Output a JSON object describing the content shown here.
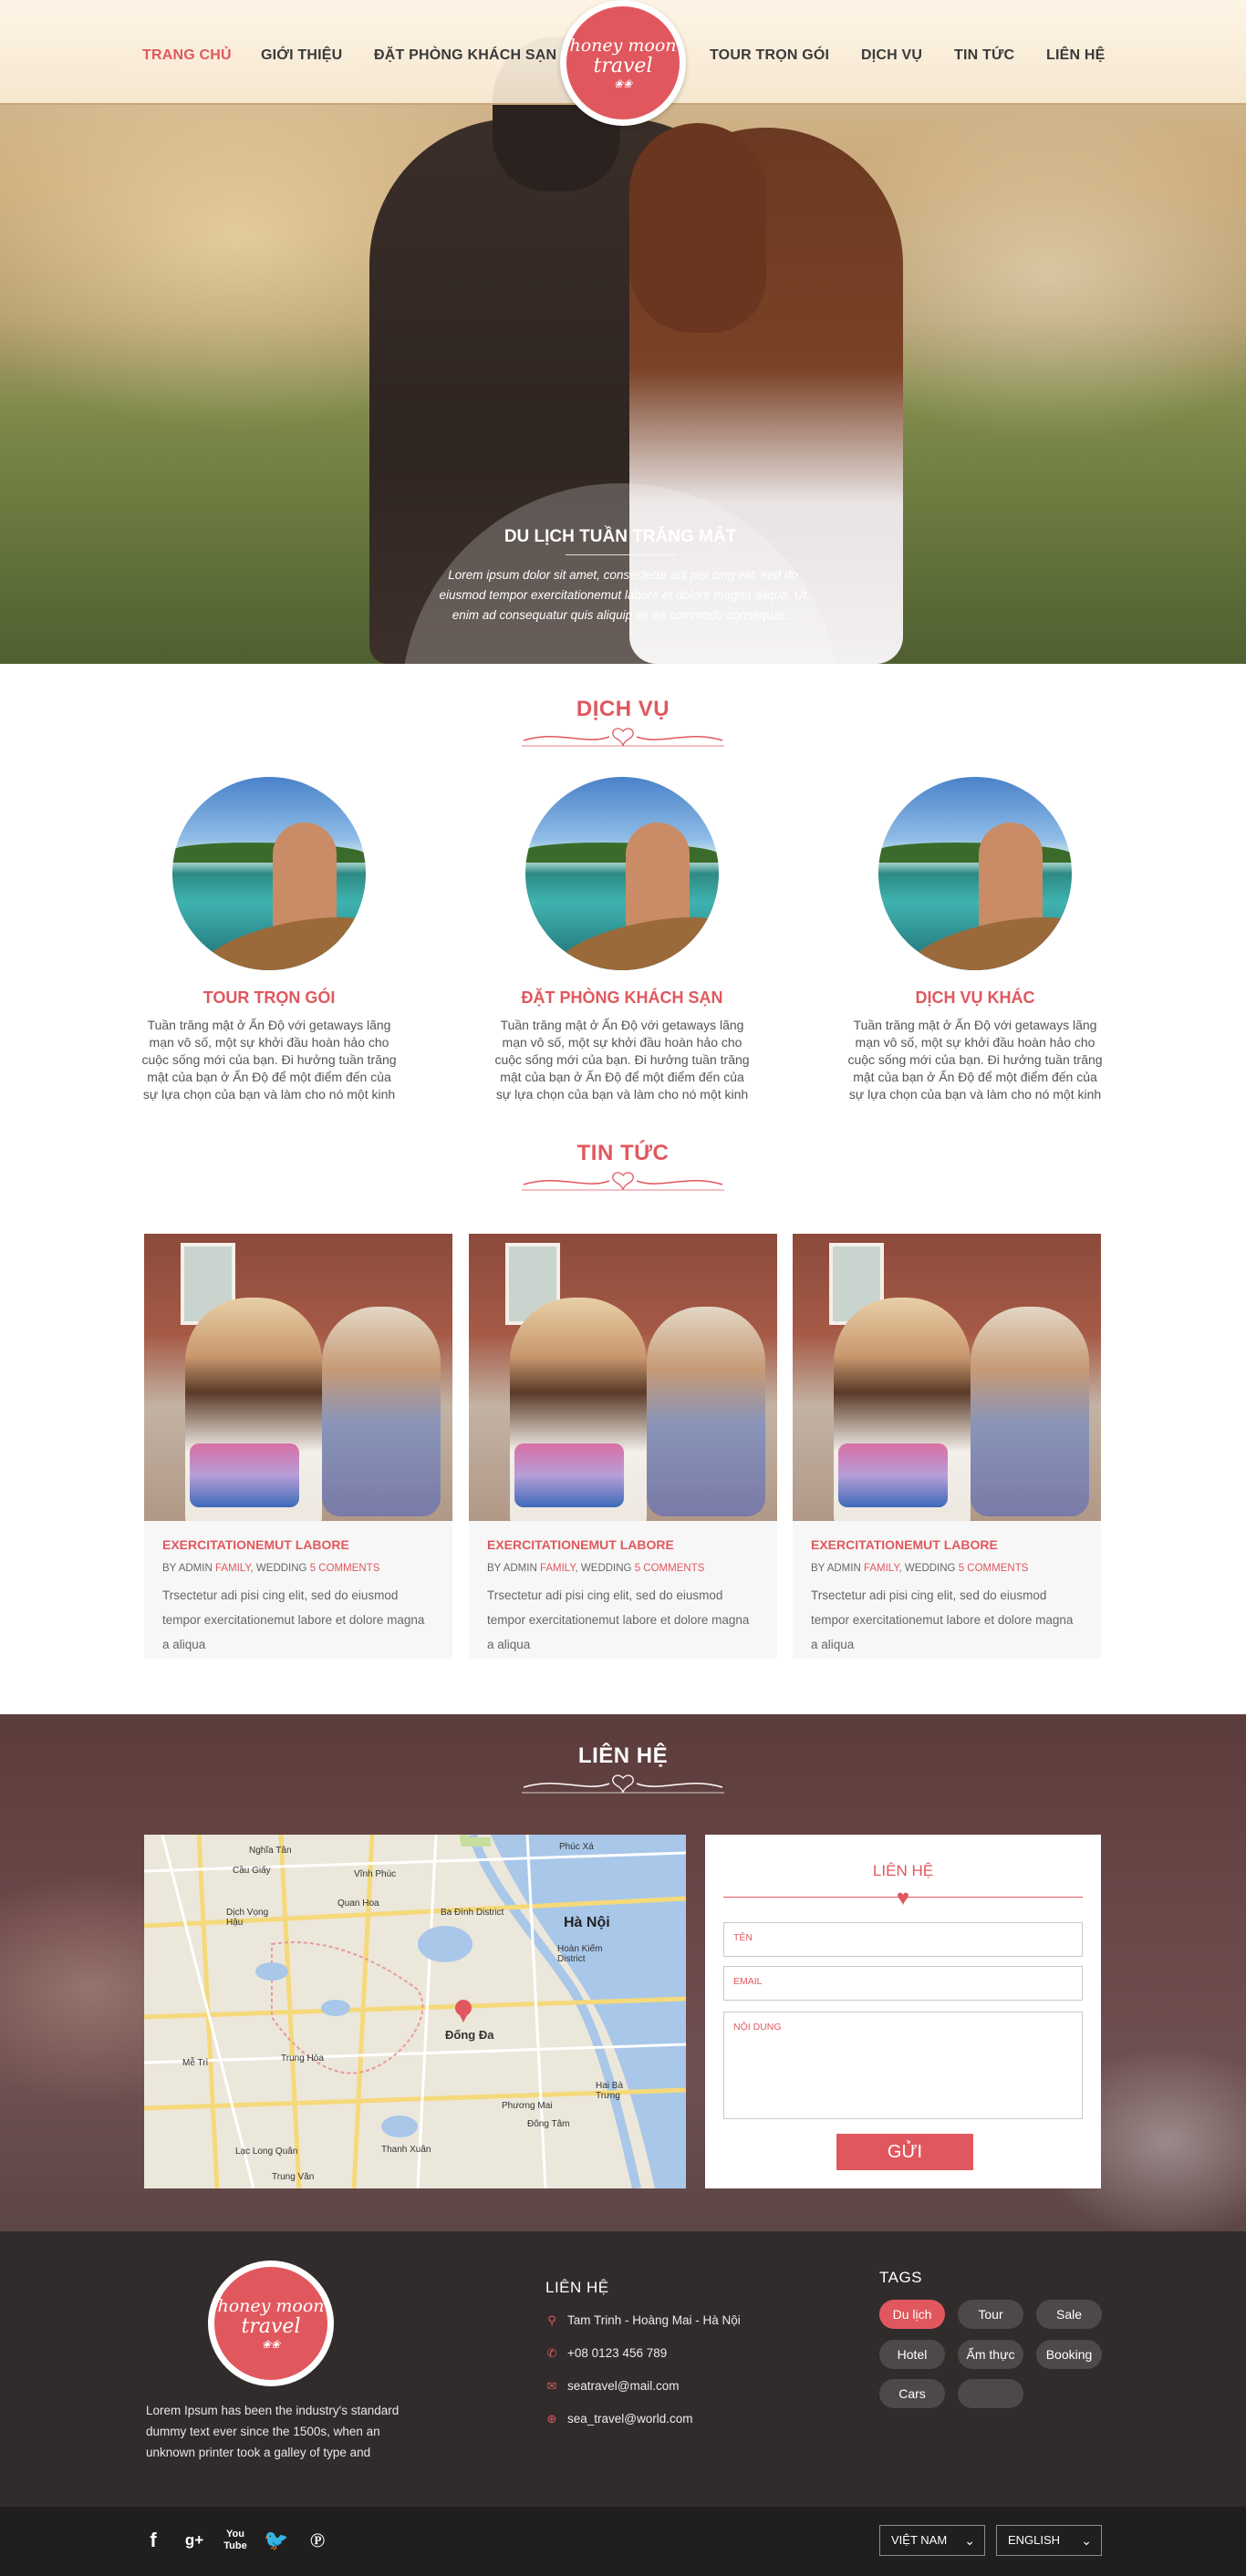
{
  "nav": {
    "items_left": [
      "TRANG CHỦ",
      "GIỚI THIỆU",
      "ĐẶT PHÒNG KHÁCH SẠN"
    ],
    "items_right": [
      "TOUR TRỌN GÓI",
      "DỊCH VỤ",
      "TIN TỨC",
      "LIÊN HỆ"
    ],
    "active": "TRANG CHỦ"
  },
  "logo": {
    "line1": "honey moon",
    "line2": "travel",
    "deco": "❀❀"
  },
  "hero": {
    "title": "DU LỊCH TUẦN TRĂNG MẬT",
    "text": "Lorem ipsum dolor sit amet, consectetur adi pisi cing elit, sed do eiusmod tempor exercitationemut labore et dolore magna aliqua. Ut enim ad consequatur quis aliquip ex ea commodo consequat..."
  },
  "services": {
    "title": "DỊCH VỤ",
    "items": [
      {
        "title": "TOUR TRỌN GÓI",
        "text": "Tuần trăng mật ở Ấn Độ với getaways lãng mạn vô số, một sự khởi đầu hoàn hảo cho cuộc sống mới của bạn. Đi hưởng tuần trăng mật của bạn ở Ấn Độ để một điểm đến của sự lựa chọn của bạn và làm cho nó một kinh"
      },
      {
        "title": "ĐẶT PHÒNG KHÁCH SẠN",
        "text": "Tuần trăng mật ở Ấn Độ với getaways lãng mạn vô số, một sự khởi đầu hoàn hảo cho cuộc sống mới của bạn. Đi hưởng tuần trăng mật của bạn ở Ấn Độ để một điểm đến của sự lựa chọn của bạn và làm cho nó một kinh"
      },
      {
        "title": "DỊCH VỤ KHÁC",
        "text": "Tuần trăng mật ở Ấn Độ với getaways lãng mạn vô số, một sự khởi đầu hoàn hảo cho cuộc sống mới của bạn. Đi hưởng tuần trăng mật của bạn ở Ấn Độ để một điểm đến của sự lựa chọn của bạn và làm cho nó một kinh"
      }
    ]
  },
  "news": {
    "title": "TIN TỨC",
    "items": [
      {
        "title": "EXERCITATIONEMUT LABORE",
        "by": "BY ADMIN",
        "cat1": "FAMILY",
        "cat2": "WEDDING",
        "comments": "5 COMMENTS",
        "text": "Trsectetur adi pisi cing elit, sed do eiusmod tempor exercitationemut labore et dolore magna a aliqua"
      },
      {
        "title": "EXERCITATIONEMUT LABORE",
        "by": "BY ADMIN",
        "cat1": "FAMILY",
        "cat2": "WEDDING",
        "comments": "5 COMMENTS",
        "text": "Trsectetur adi pisi cing elit, sed do eiusmod tempor exercitationemut labore et dolore magna a aliqua"
      },
      {
        "title": "EXERCITATIONEMUT LABORE",
        "by": "BY ADMIN",
        "cat1": "FAMILY",
        "cat2": "WEDDING",
        "comments": "5 COMMENTS",
        "text": "Trsectetur adi pisi cing elit, sed do eiusmod tempor exercitationemut labore et dolore magna a aliqua"
      }
    ]
  },
  "contact": {
    "title": "LIÊN HỆ",
    "map_labels": [
      "Cầu Giấy",
      "Vĩnh Phúc",
      "Hà Nội",
      "Ba Đình District",
      "Hoàn Kiếm District",
      "Đống Đa",
      "Thanh Xuân",
      "Mễ Trì",
      "Trung Hòa",
      "Nghĩa Tân",
      "Dịch Vọng Hậu",
      "Phúc Xá",
      "Quan Hoa",
      "Lạc Long Quân",
      "Đông Tâm",
      "Trung Văn",
      "Hai Bà Trưng",
      "Phương Mai"
    ],
    "form": {
      "title": "LIÊN HỆ",
      "name_placeholder": "TÊN",
      "email_placeholder": "EMAIL",
      "content_placeholder": "NỘI DUNG",
      "send_label": "GỬI"
    }
  },
  "footer": {
    "about": "Lorem Ipsum has been the industry's standard dummy text ever since the 1500s, when an unknown printer took a galley of type and",
    "contact_heading": "LIÊN HỆ",
    "address": "Tam Trinh - Hoàng Mai - Hà Nội",
    "phone": "+08 0123 456 789",
    "email1": "seatravel@mail.com",
    "email2": "sea_travel@world.com",
    "tags_heading": "TAGS",
    "tags": [
      "Du lịch",
      "Tour",
      "Sale",
      "Hotel",
      "Ẩm thực",
      "Booking",
      "Cars",
      ""
    ],
    "lang1": "VIỆT NAM",
    "lang2": "ENGLISH"
  }
}
